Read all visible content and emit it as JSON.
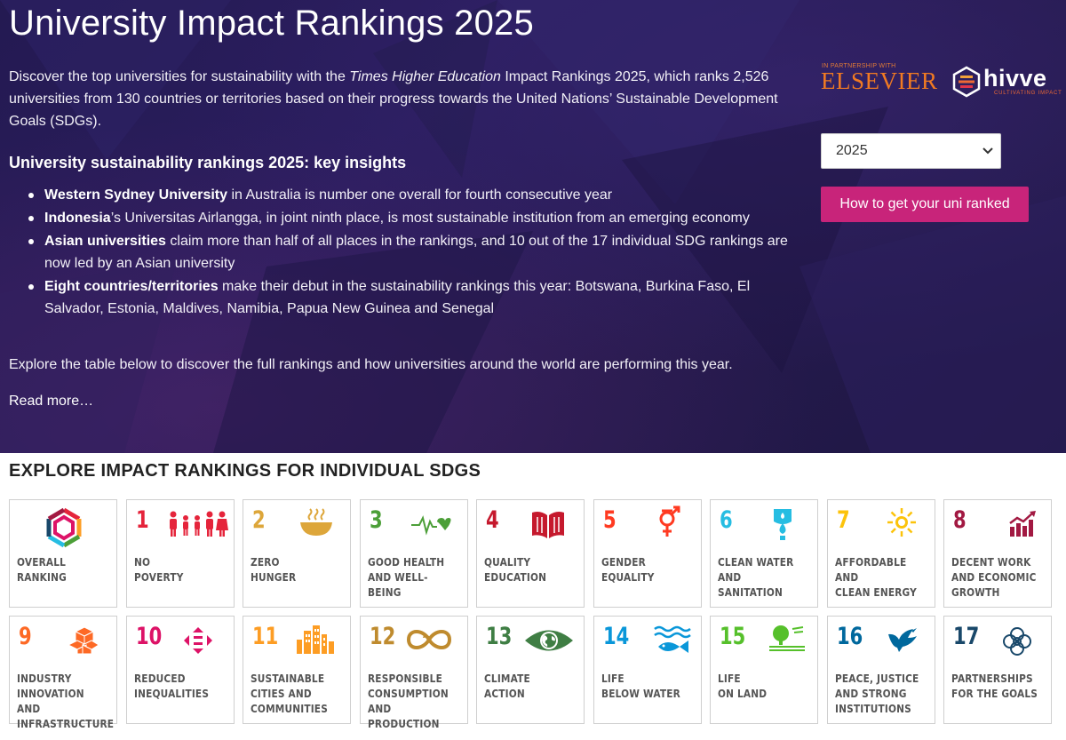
{
  "hero": {
    "title": "University Impact Rankings 2025",
    "intro_before": "Discover the top universities for sustainability with the ",
    "intro_em": "Times Higher Education",
    "intro_after": " Impact Rankings 2025, which ranks 2,526 universities from 130 countries or territories based on their progress towards the United Nations’ Sustainable Development Goals (SDGs).",
    "insights_title": "University sustainability rankings 2025: key insights",
    "insights": [
      {
        "bold": "Western Sydney University",
        "rest": " in Australia is number one overall for fourth consecutive year"
      },
      {
        "bold": "Indonesia",
        "rest": "’s Universitas Airlangga, in joint ninth place, is most sustainable institution from an emerging economy"
      },
      {
        "bold": "Asian universities",
        "rest": " claim more than half of all places in the rankings, and 10 out of the 17 individual SDG rankings are now led by an Asian university"
      },
      {
        "bold": "Eight countries/territories",
        "rest": " make their debut in the sustainability rankings this year: Botswana, Burkina Faso, El Salvador, Estonia, Maldives, Namibia, Papua New Guinea and Senegal"
      }
    ],
    "explore_text": "Explore the table below to discover the full rankings and how universities around the world are performing this year.",
    "read_more": "Read more…"
  },
  "partners": {
    "small_label": "IN PARTNERSHIP WITH",
    "elsevier": "ELSEVIER",
    "hivve": "hivve",
    "hivve_tagline": "CULTIVATING IMPACT"
  },
  "controls": {
    "year_selected": "2025",
    "ranked_button": "How to get your uni ranked"
  },
  "sdg_section": {
    "heading": "EXPLORE IMPACT RANKINGS FOR INDIVIDUAL SDGS",
    "tiles": [
      {
        "num": "",
        "label": "OVERALL\nRANKING",
        "color": "#7a4fa0",
        "icon": "overall-wheel-icon"
      },
      {
        "num": "1",
        "label": "NO\nPOVERTY",
        "color": "#e5243b",
        "icon": "family-icon"
      },
      {
        "num": "2",
        "label": "ZERO\nHUNGER",
        "color": "#dda63a",
        "icon": "food-bowl-icon"
      },
      {
        "num": "3",
        "label": "GOOD HEALTH\nAND WELL-BEING",
        "color": "#4c9f38",
        "icon": "heartbeat-icon"
      },
      {
        "num": "4",
        "label": "QUALITY\nEDUCATION",
        "color": "#c5192d",
        "icon": "book-icon"
      },
      {
        "num": "5",
        "label": "GENDER\nEQUALITY",
        "color": "#ff3a21",
        "icon": "gender-icon"
      },
      {
        "num": "6",
        "label": "CLEAN WATER\nAND SANITATION",
        "color": "#26bde2",
        "icon": "water-drop-icon"
      },
      {
        "num": "7",
        "label": "AFFORDABLE AND\nCLEAN ENERGY",
        "color": "#fcc30b",
        "icon": "sun-icon"
      },
      {
        "num": "8",
        "label": "DECENT WORK\nAND ECONOMIC\nGROWTH",
        "color": "#a21942",
        "icon": "growth-chart-icon"
      },
      {
        "num": "9",
        "label": "INDUSTRY\nINNOVATION AND\nINFRASTRUCTURE",
        "color": "#fd6925",
        "icon": "cubes-icon"
      },
      {
        "num": "10",
        "label": "REDUCED\nINEQUALITIES",
        "color": "#dd1367",
        "icon": "equality-arrows-icon"
      },
      {
        "num": "11",
        "label": "SUSTAINABLE\nCITIES AND\nCOMMUNITIES",
        "color": "#fd9d24",
        "icon": "city-icon"
      },
      {
        "num": "12",
        "label": "RESPONSIBLE\nCONSUMPTION\nAND PRODUCTION",
        "color": "#bf8b2e",
        "icon": "infinity-icon"
      },
      {
        "num": "13",
        "label": "CLIMATE\nACTION",
        "color": "#3f7e44",
        "icon": "eye-globe-icon"
      },
      {
        "num": "14",
        "label": "LIFE\nBELOW WATER",
        "color": "#0a97d9",
        "icon": "fish-icon"
      },
      {
        "num": "15",
        "label": "LIFE\nON LAND",
        "color": "#56c02b",
        "icon": "tree-icon"
      },
      {
        "num": "16",
        "label": "PEACE, JUSTICE\nAND STRONG\nINSTITUTIONS",
        "color": "#00689d",
        "icon": "dove-icon"
      },
      {
        "num": "17",
        "label": "PARTNERSHIPS\nFOR THE GOALS",
        "color": "#19486a",
        "icon": "rings-icon"
      }
    ]
  }
}
